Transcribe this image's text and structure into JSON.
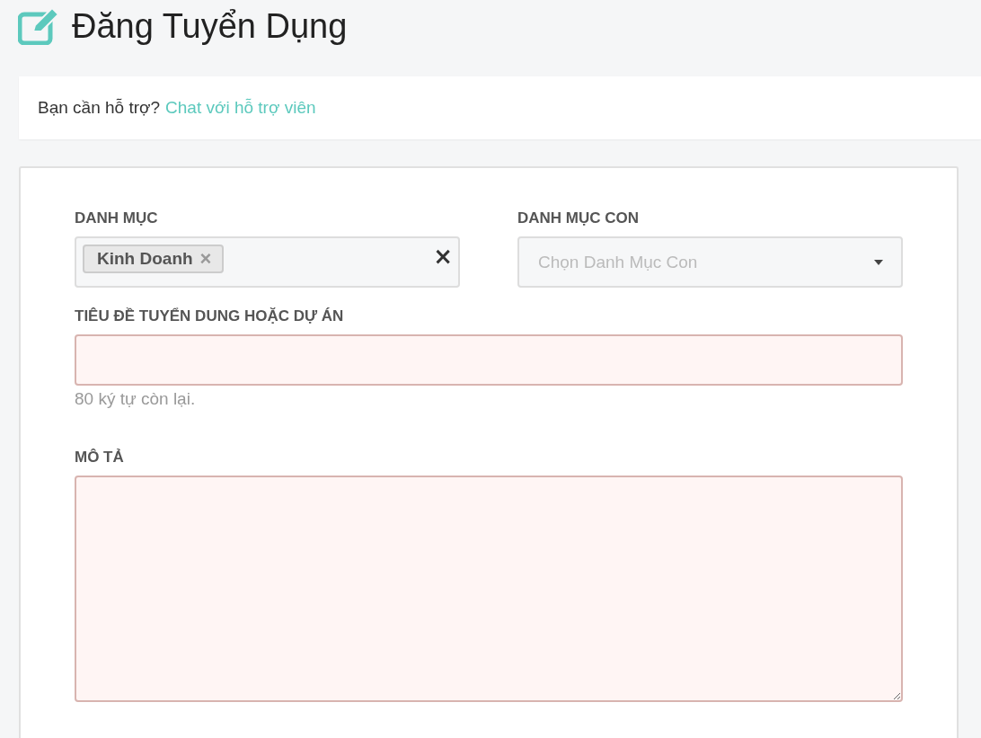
{
  "page_title": "Đăng Tuyển Dụng",
  "help_bar": {
    "text": "Bạn cần hỗ trợ?",
    "link": "Chat với hỗ trợ viên"
  },
  "form": {
    "category": {
      "label": "DANH MỤC",
      "tags": [
        {
          "label": "Kinh Doanh",
          "remove": "×"
        }
      ],
      "clear": "×"
    },
    "subcategory": {
      "label": "DANH MỤC CON",
      "placeholder": "Chọn Danh Mục Con"
    },
    "title_field": {
      "label": "TIÊU ĐỀ TUYỂN DUNG HOẶC DỰ ÁN",
      "error": true,
      "hint": "80 ký tự còn lại."
    },
    "description": {
      "label": "MÔ TẢ",
      "error": true
    }
  }
}
